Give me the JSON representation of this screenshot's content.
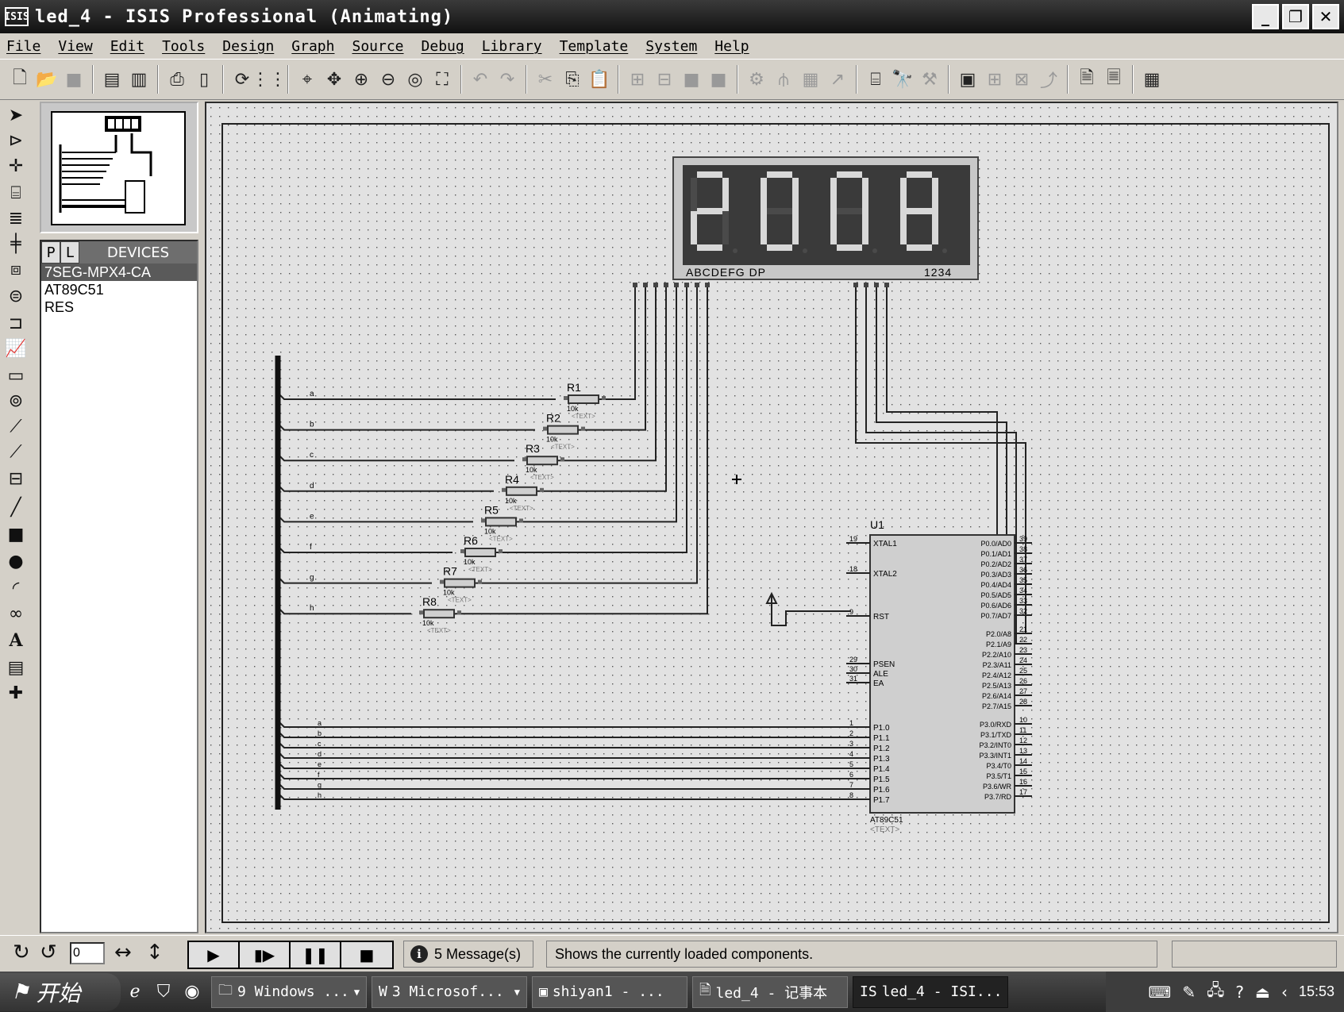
{
  "window": {
    "title": "led_4 - ISIS Professional (Animating)",
    "app_icon_text": "ISIS",
    "minimize_icon": "minimize-icon",
    "maximize_icon": "restore-icon",
    "close_icon": "close-icon"
  },
  "menu": [
    "File",
    "View",
    "Edit",
    "Tools",
    "Design",
    "Graph",
    "Source",
    "Debug",
    "Library",
    "Template",
    "System",
    "Help"
  ],
  "devices_panel": {
    "tab_p": "P",
    "tab_l": "L",
    "title": "DEVICES",
    "items": [
      "7SEG-MPX4-CA",
      "AT89C51",
      "RES"
    ],
    "selected_index": 0
  },
  "schematic": {
    "display": {
      "digits": [
        "2",
        "0",
        "0",
        "8"
      ],
      "segment_label": "ABCDEFG DP",
      "common_label": "1234"
    },
    "resistors": [
      {
        "ref": "R1",
        "value": "10k",
        "text": "<TEXT>"
      },
      {
        "ref": "R2",
        "value": "10k",
        "text": "<TEXT>"
      },
      {
        "ref": "R3",
        "value": "10k",
        "text": "<TEXT>"
      },
      {
        "ref": "R4",
        "value": "10k",
        "text": "<TEXT>"
      },
      {
        "ref": "R5",
        "value": "10k",
        "text": "<TEXT>"
      },
      {
        "ref": "R6",
        "value": "10k",
        "text": "<TEXT>"
      },
      {
        "ref": "R7",
        "value": "10k",
        "text": "<TEXT>"
      },
      {
        "ref": "R8",
        "value": "10k",
        "text": "<TEXT>"
      }
    ],
    "bus_labels_top": [
      "a",
      "b",
      "c",
      "d",
      "e",
      "f",
      "g",
      "h"
    ],
    "bus_labels_bottom": [
      "a",
      "b",
      "c",
      "d",
      "e",
      "f",
      "g",
      "h"
    ],
    "mcu": {
      "ref": "U1",
      "part": "AT89C51",
      "text": "<TEXT>",
      "left_pins": [
        {
          "num": "19",
          "name": "XTAL1"
        },
        {
          "num": "18",
          "name": "XTAL2"
        },
        {
          "num": "9",
          "name": "RST"
        },
        {
          "num": "29",
          "name": "PSEN"
        },
        {
          "num": "30",
          "name": "ALE"
        },
        {
          "num": "31",
          "name": "EA"
        },
        {
          "num": "1",
          "name": "P1.0"
        },
        {
          "num": "2",
          "name": "P1.1"
        },
        {
          "num": "3",
          "name": "P1.2"
        },
        {
          "num": "4",
          "name": "P1.3"
        },
        {
          "num": "5",
          "name": "P1.4"
        },
        {
          "num": "6",
          "name": "P1.5"
        },
        {
          "num": "7",
          "name": "P1.6"
        },
        {
          "num": "8",
          "name": "P1.7"
        }
      ],
      "right_pins": [
        {
          "num": "39",
          "name": "P0.0/AD0"
        },
        {
          "num": "38",
          "name": "P0.1/AD1"
        },
        {
          "num": "37",
          "name": "P0.2/AD2"
        },
        {
          "num": "36",
          "name": "P0.3/AD3"
        },
        {
          "num": "35",
          "name": "P0.4/AD4"
        },
        {
          "num": "34",
          "name": "P0.5/AD5"
        },
        {
          "num": "33",
          "name": "P0.6/AD6"
        },
        {
          "num": "32",
          "name": "P0.7/AD7"
        },
        {
          "num": "21",
          "name": "P2.0/A8"
        },
        {
          "num": "22",
          "name": "P2.1/A9"
        },
        {
          "num": "23",
          "name": "P2.2/A10"
        },
        {
          "num": "24",
          "name": "P2.3/A11"
        },
        {
          "num": "25",
          "name": "P2.4/A12"
        },
        {
          "num": "26",
          "name": "P2.5/A13"
        },
        {
          "num": "27",
          "name": "P2.6/A14"
        },
        {
          "num": "28",
          "name": "P2.7/A15"
        },
        {
          "num": "10",
          "name": "P3.0/RXD"
        },
        {
          "num": "11",
          "name": "P3.1/TXD"
        },
        {
          "num": "12",
          "name": "P3.2/INT0"
        },
        {
          "num": "13",
          "name": "P3.3/INT1"
        },
        {
          "num": "14",
          "name": "P3.4/T0"
        },
        {
          "num": "15",
          "name": "P3.5/T1"
        },
        {
          "num": "16",
          "name": "P3.6/WR"
        },
        {
          "num": "17",
          "name": "P3.7/RD"
        }
      ]
    }
  },
  "statusbar": {
    "rotation_value": "0",
    "messages": "5 Message(s)",
    "status_text": "Shows the currently loaded components."
  },
  "taskbar": {
    "start_label": "开始",
    "tasks": [
      {
        "label": "9 Windows ...",
        "icon": "folder-icon",
        "has_arrow": true
      },
      {
        "label": "3 Microsof...",
        "icon": "word-icon",
        "has_arrow": true
      },
      {
        "label": "shiyan1 - ...",
        "icon": "app-icon",
        "has_arrow": false
      },
      {
        "label": "led_4 - 记事本",
        "icon": "notepad-icon",
        "has_arrow": false
      },
      {
        "label": "led_4 - ISI...",
        "icon": "isis-icon",
        "has_arrow": false
      }
    ],
    "clock": "15:53"
  }
}
